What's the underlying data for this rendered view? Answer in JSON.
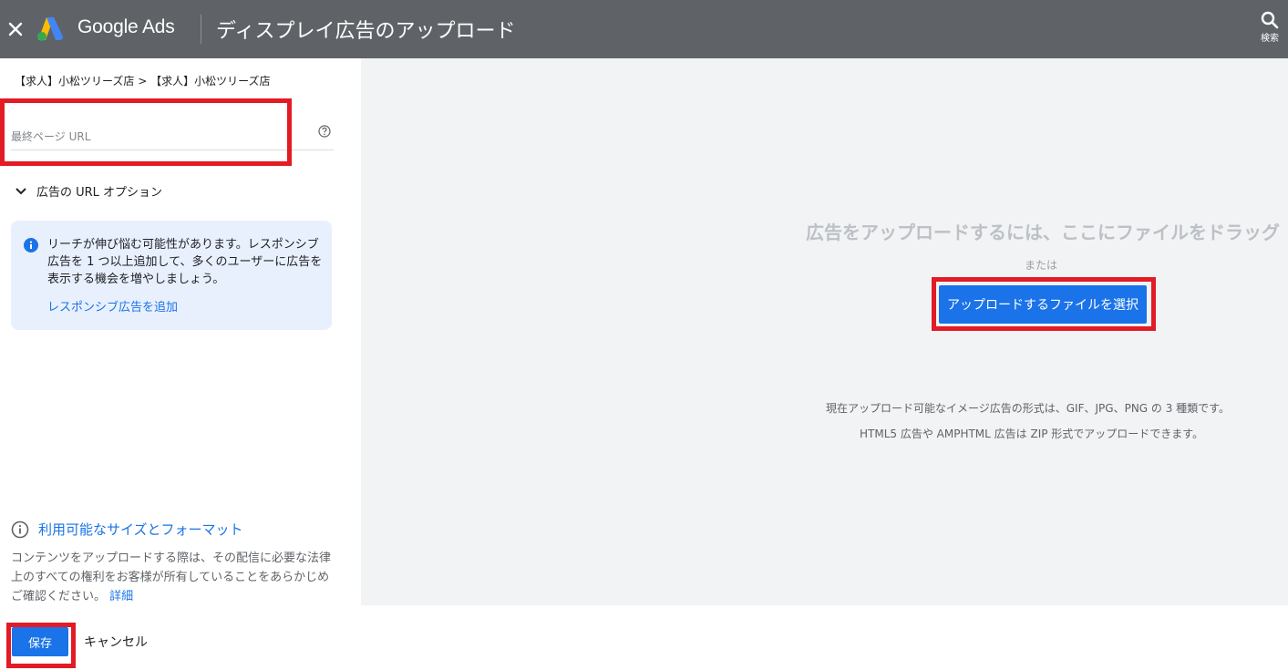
{
  "header": {
    "brand": "Google Ads",
    "title": "ディスプレイ広告のアップロード",
    "search_label": "検索"
  },
  "left": {
    "breadcrumb": "【求人】小松ツリーズ店 > 【求人】小松ツリーズ店",
    "final_url_placeholder": "最終ページ URL",
    "url_options_label": "広告の URL オプション",
    "info_card": {
      "text": "リーチが伸び悩む可能性があります。レスポンシブ広告を 1 つ以上追加して、多くのユーザーに広告を表示する機会を増やしましょう。",
      "link": "レスポンシブ広告を追加"
    },
    "sizes_link": "利用可能なサイズとフォーマット",
    "legal_text": "コンテンツをアップロードする際は、その配信に必要な法律上のすべての権利をお客様が所有していることをあらかじめご確認ください。",
    "legal_more": "詳細"
  },
  "right": {
    "drop_title": "広告をアップロードするには、ここにファイルをドラッグ",
    "or_text": "または",
    "upload_button": "アップロードするファイルを選択",
    "formats_line1": "現在アップロード可能なイメージ広告の形式は、GIF、JPG、PNG の 3 種類です。",
    "formats_line2": "HTML5 広告や AMPHTML 広告は ZIP 形式でアップロードできます。"
  },
  "footer": {
    "save": "保存",
    "cancel": "キャンセル"
  },
  "colors": {
    "header_bg": "#5f6368",
    "accent": "#1a73e8",
    "highlight_box": "#e21b25",
    "info_card_bg": "#e8f0fe",
    "drop_area_bg": "#f1f3f4"
  },
  "icons": [
    "close-icon",
    "google-ads-logo",
    "search-icon",
    "help-icon",
    "chevron-down-icon",
    "info-icon",
    "info-outline-icon"
  ]
}
